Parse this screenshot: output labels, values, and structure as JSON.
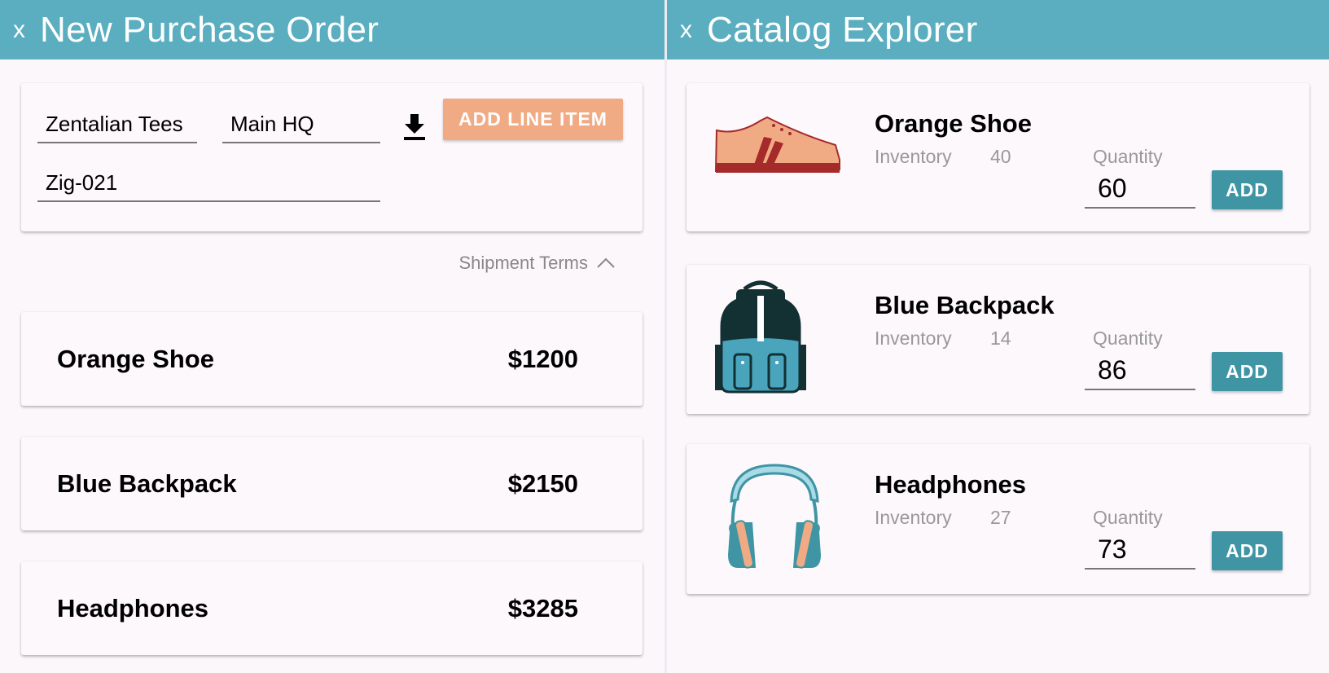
{
  "left_panel": {
    "close_label": "x",
    "title": "New Purchase Order",
    "form": {
      "vendor": "Zentalian Tees",
      "location": "Main HQ",
      "reference": "Zig-021",
      "add_line_item_label": "ADD LINE ITEM",
      "download_icon": "download-icon"
    },
    "shipment_terms_label": "Shipment Terms",
    "line_items": [
      {
        "name": "Orange Shoe",
        "price": "$1200"
      },
      {
        "name": "Blue Backpack",
        "price": "$2150"
      },
      {
        "name": "Headphones",
        "price": "$3285"
      }
    ]
  },
  "right_panel": {
    "close_label": "x",
    "title": "Catalog Explorer",
    "inventory_label": "Inventory",
    "quantity_label": "Quantity",
    "add_label": "ADD",
    "products": [
      {
        "name": "Orange Shoe",
        "inventory": "40",
        "quantity": "60",
        "icon": "shoe-image"
      },
      {
        "name": "Blue Backpack",
        "inventory": "14",
        "quantity": "86",
        "icon": "backpack-image"
      },
      {
        "name": "Headphones",
        "inventory": "27",
        "quantity": "73",
        "icon": "headphones-image"
      }
    ]
  },
  "colors": {
    "header": "#5aaec0",
    "primary_button": "#3f95a4",
    "accent_button": "#f0ab85",
    "background": "#fcf7fb"
  }
}
